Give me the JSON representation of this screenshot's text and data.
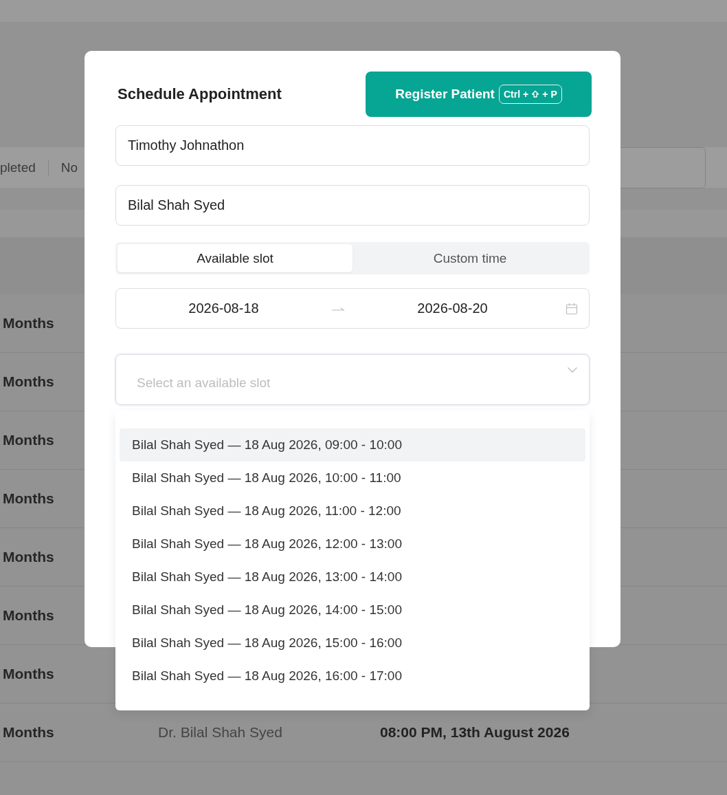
{
  "background": {
    "filters": [
      {
        "label": "pleted"
      },
      {
        "label": "No"
      }
    ],
    "table": {
      "rows": [
        {
          "duration": "Months"
        },
        {
          "duration": "Months"
        },
        {
          "duration": "Months"
        },
        {
          "duration": "Months"
        },
        {
          "duration": "Months"
        },
        {
          "duration": "Months"
        },
        {
          "duration": "Months"
        },
        {
          "duration": "Months",
          "doctor": "Dr. Bilal Shah Syed",
          "time": "08:00 PM, 13th August 2026"
        }
      ]
    }
  },
  "modal": {
    "title": "Schedule Appointment",
    "register_button": {
      "label": "Register Patient",
      "shortcut": [
        "Ctrl",
        "+",
        "+",
        "P"
      ]
    },
    "patient_field": {
      "value": "Timothy Johnathon"
    },
    "doctor_field": {
      "value": "Bilal Shah Syed"
    },
    "mode_tabs": [
      {
        "label": "Available slot",
        "selected": true
      },
      {
        "label": "Custom time",
        "selected": false
      }
    ],
    "date_range": {
      "start": "2026-08-18",
      "end": "2026-08-20"
    },
    "slot_select": {
      "placeholder": "Select an available slot",
      "expanded": true,
      "options": [
        {
          "label": "Bilal Shah Syed — 18 Aug 2026, 09:00 - 10:00",
          "selected": true
        },
        {
          "label": "Bilal Shah Syed — 18 Aug 2026, 10:00 - 11:00",
          "selected": false
        },
        {
          "label": "Bilal Shah Syed — 18 Aug 2026, 11:00 - 12:00",
          "selected": false
        },
        {
          "label": "Bilal Shah Syed — 18 Aug 2026, 12:00 - 13:00",
          "selected": false
        },
        {
          "label": "Bilal Shah Syed — 18 Aug 2026, 13:00 - 14:00",
          "selected": false
        },
        {
          "label": "Bilal Shah Syed — 18 Aug 2026, 14:00 - 15:00",
          "selected": false
        },
        {
          "label": "Bilal Shah Syed — 18 Aug 2026, 15:00 - 16:00",
          "selected": false
        },
        {
          "label": "Bilal Shah Syed — 18 Aug 2026, 16:00 - 17:00",
          "selected": false
        }
      ]
    }
  }
}
